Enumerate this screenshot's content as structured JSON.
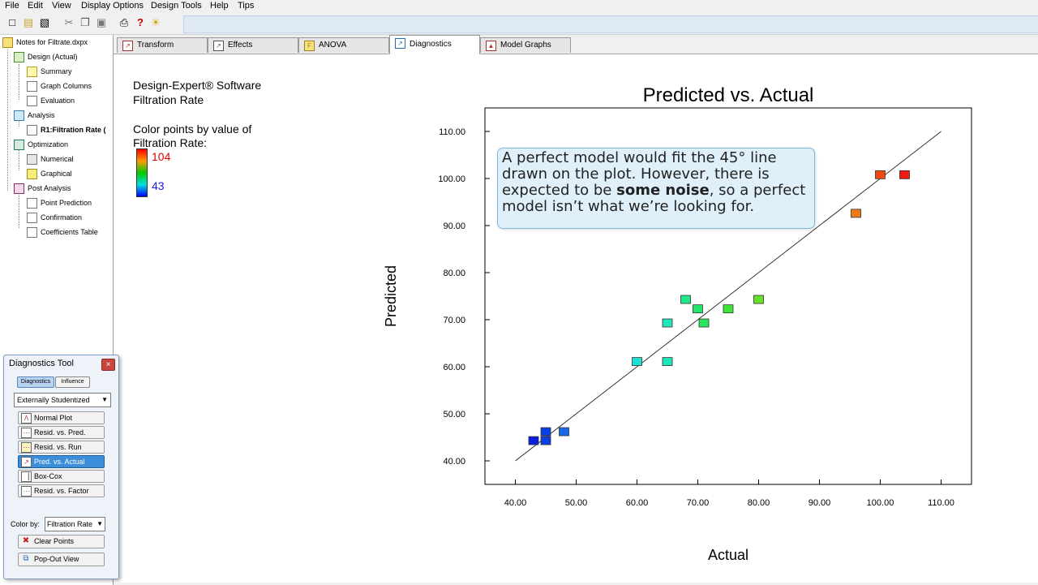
{
  "menu": [
    "File",
    "Edit",
    "View",
    "Display Options",
    "Design Tools",
    "Help",
    "Tips"
  ],
  "toolbar_icons": [
    "new-icon",
    "open-icon",
    "save-icon",
    "cut-icon",
    "copy-icon",
    "paste-icon",
    "print-icon",
    "help-icon",
    "tip-icon"
  ],
  "tree": {
    "root": "Notes for Filtrate.dxpx",
    "design": "Design (Actual)",
    "design_children": [
      "Summary",
      "Graph Columns",
      "Evaluation"
    ],
    "analysis": "Analysis",
    "analysis_child": "R1:Filtration Rate (",
    "optimization": "Optimization",
    "optimization_children": [
      "Numerical",
      "Graphical"
    ],
    "post": "Post Analysis",
    "post_children": [
      "Point Prediction",
      "Confirmation",
      "Coefficients Table"
    ]
  },
  "tabs": [
    "Transform",
    "Effects",
    "ANOVA",
    "Diagnostics",
    "Model Graphs"
  ],
  "info": {
    "software": "Design-Expert® Software",
    "response": "Filtration Rate",
    "color_by_line1": "Color points by value of",
    "color_by_line2": "Filtration Rate:",
    "max": "104",
    "min": "43"
  },
  "callout": {
    "before": "A perfect model would fit the 45° line drawn on the plot.  However, there is expected to be ",
    "bold": "some noise",
    "after": ", so a perfect model isn’t what we’re looking for."
  },
  "diagnostics_tool": {
    "title": "Diagnostics Tool",
    "close": "×",
    "tab_diagnostics": "Diagnostics",
    "tab_influence": "Influence",
    "residual_type": "Externally Studentized",
    "plots": [
      "Normal Plot",
      "Resid. vs. Pred.",
      "Resid. vs. Run",
      "Pred. vs. Actual",
      "Box-Cox",
      "Resid. vs. Factor"
    ],
    "color_by_label": "Color by:",
    "color_by_value": "Filtration Rate",
    "clear_points": "Clear Points",
    "pop_out": "Pop-Out View"
  },
  "chart_data": {
    "type": "scatter",
    "title": "Predicted vs. Actual",
    "xlabel": "Actual",
    "ylabel": "Predicted",
    "xlim": [
      35,
      115
    ],
    "ylim": [
      35,
      115
    ],
    "xticks": [
      "40.00",
      "50.00",
      "60.00",
      "70.00",
      "80.00",
      "90.00",
      "100.00",
      "110.00"
    ],
    "yticks": [
      "40.00",
      "50.00",
      "60.00",
      "70.00",
      "80.00",
      "90.00",
      "100.00",
      "110.00"
    ],
    "reference_line": [
      [
        40,
        40
      ],
      [
        110,
        110
      ]
    ],
    "points": [
      {
        "x": 43,
        "y": 44.3,
        "color": "#0a1fe0"
      },
      {
        "x": 45,
        "y": 46.2,
        "color": "#0b3fe6"
      },
      {
        "x": 45,
        "y": 44.3,
        "color": "#0b3fe6"
      },
      {
        "x": 48,
        "y": 46.2,
        "color": "#1769e8"
      },
      {
        "x": 60,
        "y": 61.1,
        "color": "#1fe0d5"
      },
      {
        "x": 65,
        "y": 61.1,
        "color": "#1fe6b9"
      },
      {
        "x": 65,
        "y": 69.3,
        "color": "#1fe6b9"
      },
      {
        "x": 68,
        "y": 74.3,
        "color": "#22e68a"
      },
      {
        "x": 70,
        "y": 72.3,
        "color": "#22e668"
      },
      {
        "x": 71,
        "y": 69.3,
        "color": "#2be65c"
      },
      {
        "x": 75,
        "y": 72.3,
        "color": "#3ee63a"
      },
      {
        "x": 80,
        "y": 74.3,
        "color": "#66e02a"
      },
      {
        "x": 96,
        "y": 92.6,
        "color": "#f07a18"
      },
      {
        "x": 100,
        "y": 100.8,
        "color": "#f04810"
      },
      {
        "x": 104,
        "y": 100.8,
        "color": "#f01810"
      }
    ]
  }
}
